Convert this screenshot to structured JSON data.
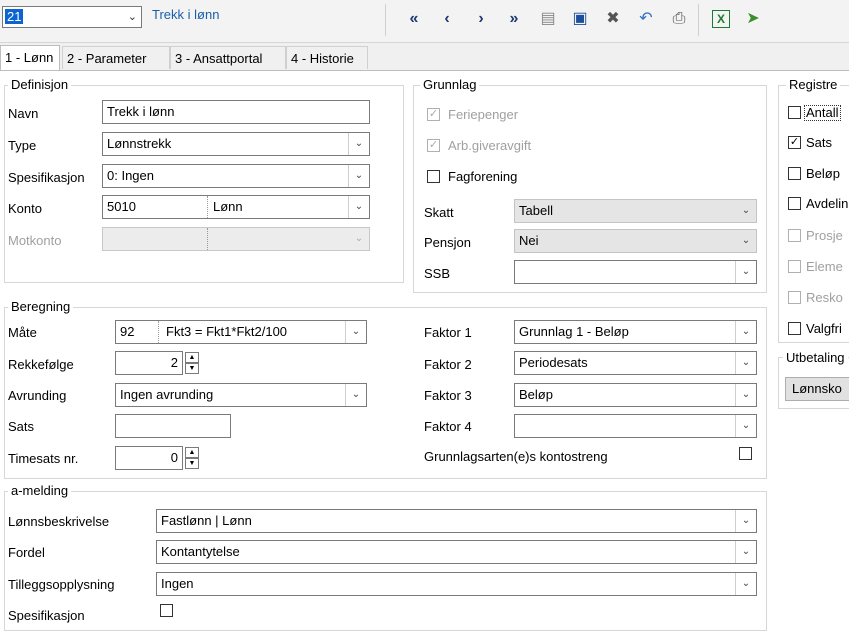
{
  "toolbar": {
    "record_number": "21",
    "record_title": "Trekk i lønn",
    "buttons": [
      "first-icon",
      "prev-icon",
      "next-icon",
      "last-icon",
      "new-icon",
      "save-icon",
      "delete-icon",
      "undo-icon",
      "print-icon",
      "excel-icon",
      "export-icon"
    ]
  },
  "tabs": [
    "1 - Lønn",
    "2 - Parameter",
    "3 - Ansattportal",
    "4 - Historie"
  ],
  "definisjon": {
    "title": "Definisjon",
    "navn_label": "Navn",
    "navn_value": "Trekk i lønn",
    "type_label": "Type",
    "type_value": "Lønnstrekk",
    "spes_label": "Spesifikasjon",
    "spes_value": "0: Ingen",
    "konto_label": "Konto",
    "konto_value": "5010",
    "konto_name": "Lønn",
    "motkonto_label": "Motkonto"
  },
  "grunnlag": {
    "title": "Grunnlag",
    "feriepenger": "Feriepenger",
    "arbgiver": "Arb.giveravgift",
    "fagforening": "Fagforening",
    "skatt_label": "Skatt",
    "skatt_value": "Tabell",
    "pensjon_label": "Pensjon",
    "pensjon_value": "Nei",
    "ssb_label": "SSB",
    "ssb_value": ""
  },
  "registrering": {
    "title": "Registre",
    "items": [
      "Antall",
      "Sats",
      "Beløp",
      "Avdelin",
      "Prosje",
      "Eleme",
      "Resko",
      "Valgfri"
    ]
  },
  "utbetaling": {
    "title": "Utbetaling",
    "button": "Lønnsko"
  },
  "beregning": {
    "title": "Beregning",
    "mate_label": "Måte",
    "mate_code": "92",
    "mate_formula": "Fkt3 = Fkt1*Fkt2/100",
    "rekke_label": "Rekkefølge",
    "rekke_value": "2",
    "avrunding_label": "Avrunding",
    "avrunding_value": "Ingen avrunding",
    "sats_label": "Sats",
    "sats_value": "",
    "timesats_label": "Timesats nr.",
    "timesats_value": "0",
    "faktor1_label": "Faktor 1",
    "faktor1_value": "Grunnlag 1 - Beløp",
    "faktor2_label": "Faktor 2",
    "faktor2_value": "Periodesats",
    "faktor3_label": "Faktor 3",
    "faktor3_value": "Beløp",
    "faktor4_label": "Faktor 4",
    "faktor4_value": "",
    "kontostreng_label": "Grunnlagsarten(e)s kontostreng"
  },
  "amelding": {
    "title": "a-melding",
    "lonnsbeskrivelse_label": "Lønnsbeskrivelse",
    "lonnsbeskrivelse_value": "Fastlønn | Lønn",
    "fordel_label": "Fordel",
    "fordel_value": "Kontantytelse",
    "tillegg_label": "Tilleggsopplysning",
    "tillegg_value": "Ingen",
    "spes_label": "Spesifikasjon"
  }
}
